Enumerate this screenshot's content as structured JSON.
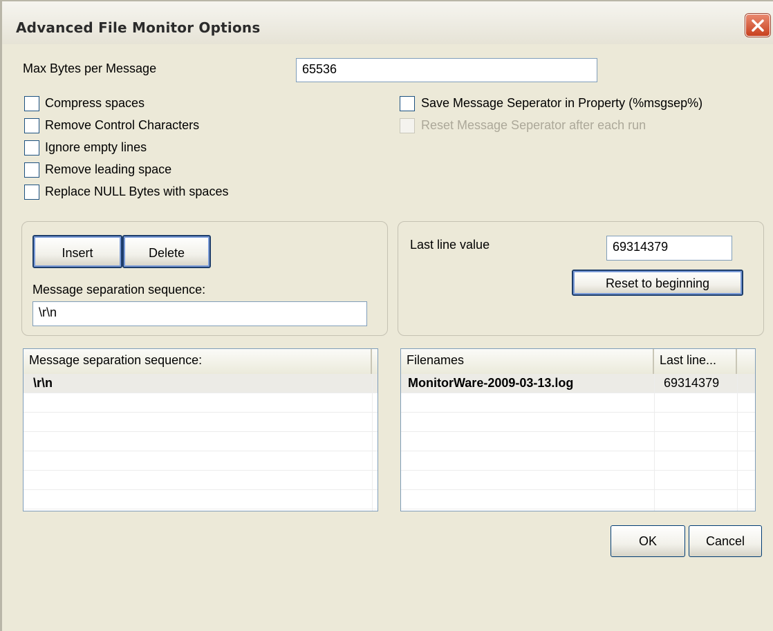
{
  "window": {
    "title": "Advanced File Monitor Options"
  },
  "max_bytes": {
    "label": "Max Bytes per Message",
    "value": "65536"
  },
  "options_left": [
    {
      "label": "Compress spaces",
      "checked": false
    },
    {
      "label": "Remove Control Characters",
      "checked": false
    },
    {
      "label": "Ignore empty lines",
      "checked": false
    },
    {
      "label": "Remove leading space",
      "checked": false
    },
    {
      "label": "Replace NULL Bytes with spaces",
      "checked": false
    }
  ],
  "options_right": [
    {
      "label": "Save Message Seperator in Property (%msgsep%)",
      "checked": false,
      "enabled": true
    },
    {
      "label": "Reset Message Seperator after each run",
      "checked": false,
      "enabled": false
    }
  ],
  "separator_group": {
    "insert_label": "Insert",
    "delete_label": "Delete",
    "sequence_label": "Message separation sequence:",
    "sequence_value": "\\r\\n"
  },
  "lastline_group": {
    "label": "Last line value",
    "value": "69314379",
    "reset_label": "Reset to beginning"
  },
  "separator_list": {
    "header": "Message separation sequence:",
    "rows": [
      "\\r\\n"
    ]
  },
  "files_list": {
    "headers": [
      "Filenames",
      "Last line..."
    ],
    "rows": [
      {
        "filename": "MonitorWare-2009-03-13.log",
        "last_line": "69314379"
      }
    ]
  },
  "footer": {
    "ok_label": "OK",
    "cancel_label": "Cancel"
  }
}
